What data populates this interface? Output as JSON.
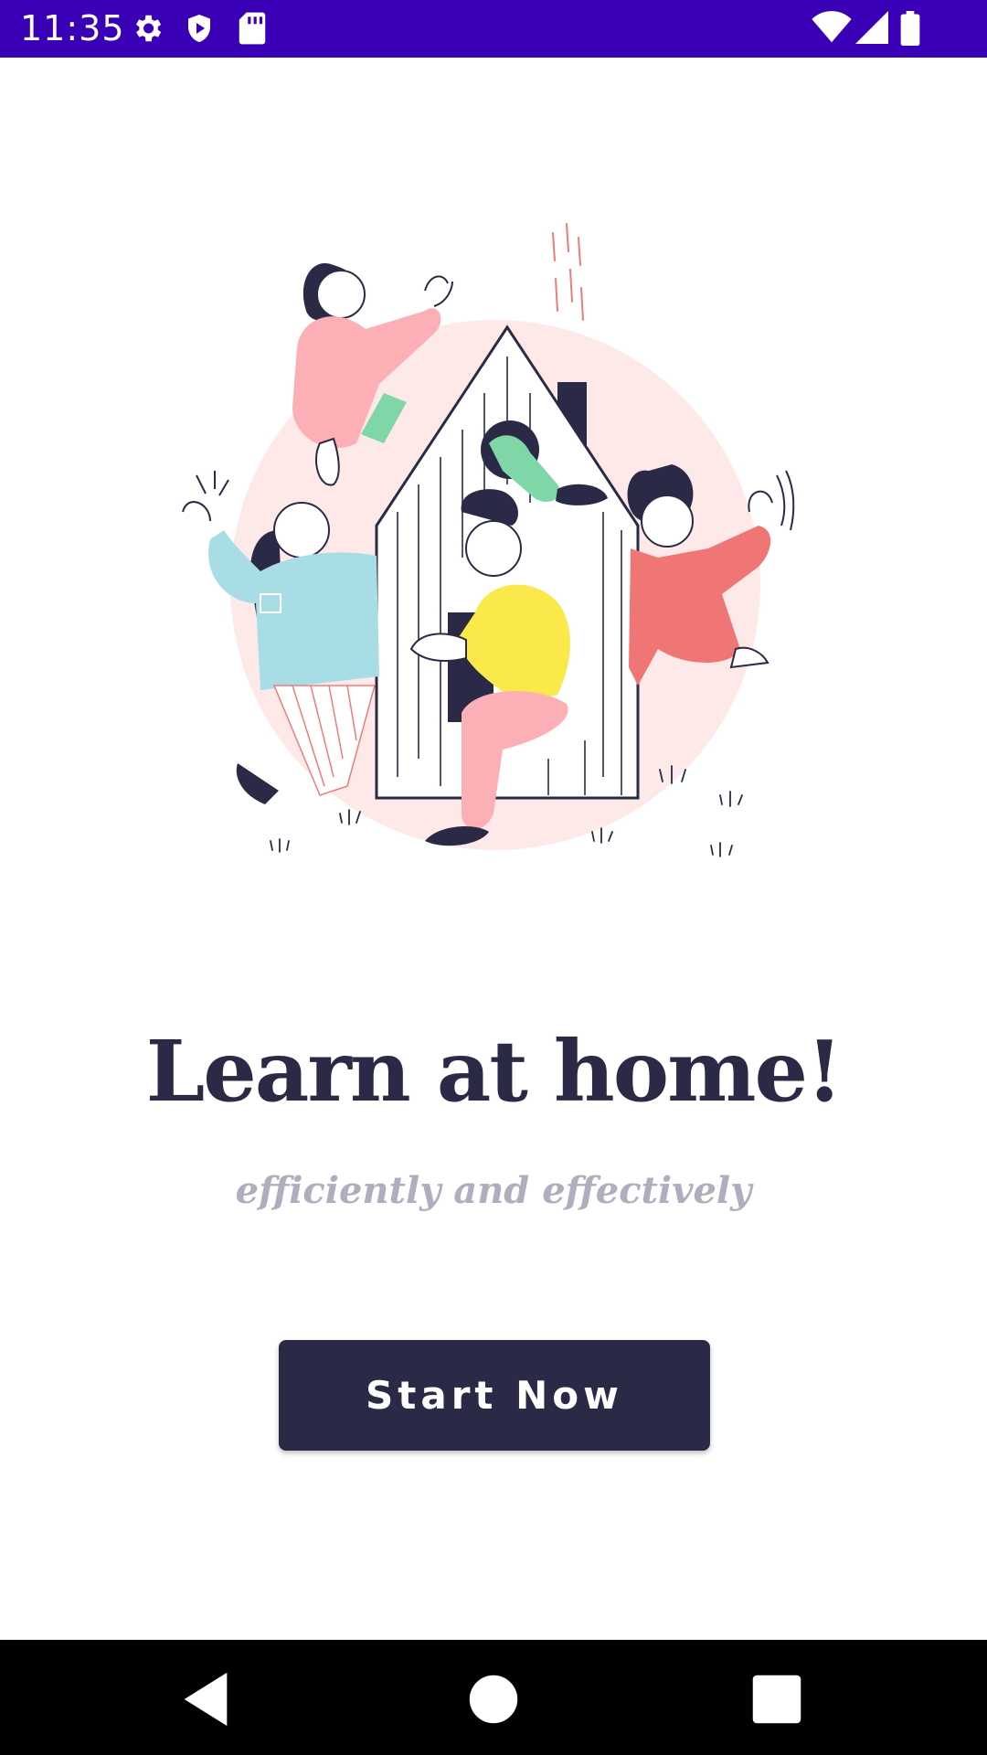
{
  "status_bar": {
    "time": "11:35",
    "icons": [
      "settings-icon",
      "shield-play-icon",
      "sd-card-icon",
      "wifi-icon",
      "signal-icon",
      "battery-icon"
    ],
    "background": "#3a00b5"
  },
  "hero": {
    "illustration": "people-around-house-illustration"
  },
  "main": {
    "title": "Learn at home!",
    "subtitle": "efficiently and effectively",
    "start_button_label": "Start Now",
    "accent": "#2b2a46"
  },
  "nav_bar": {
    "icons": [
      "back-icon",
      "home-icon",
      "recents-icon"
    ]
  }
}
